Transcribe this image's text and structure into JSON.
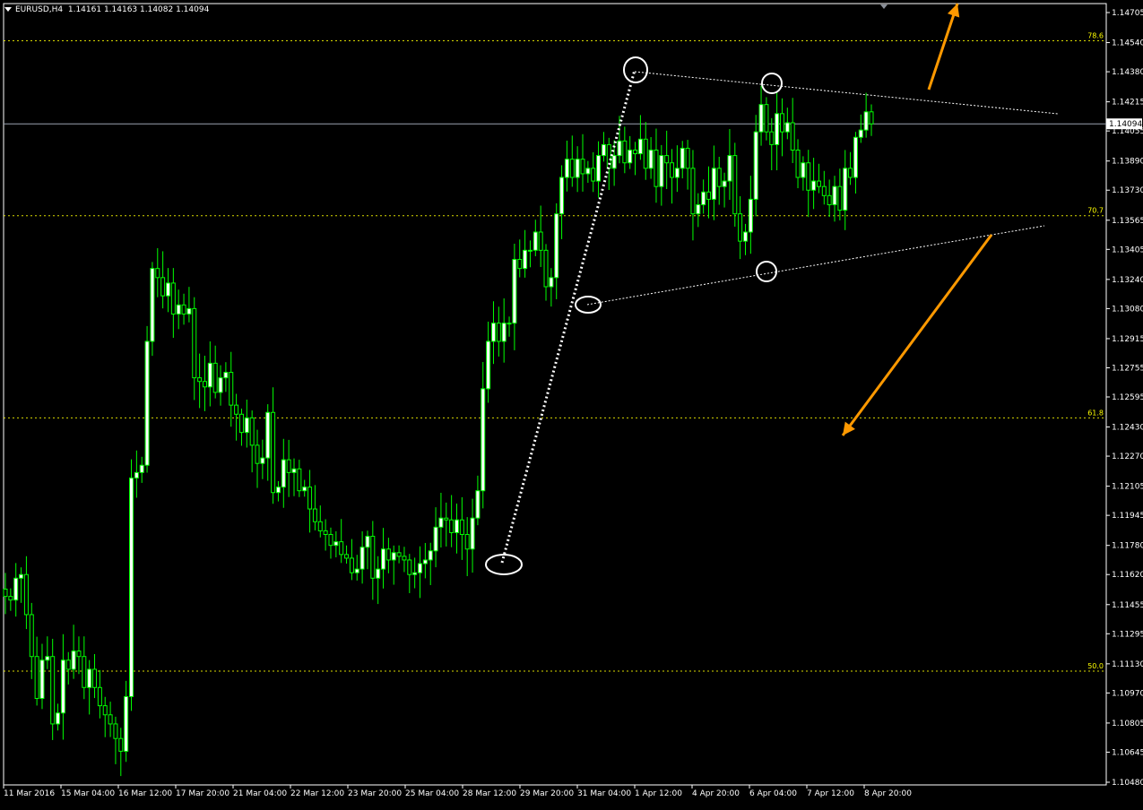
{
  "header": {
    "symbol": "EURUSD,H4",
    "ohlc": "1.14161 1.14163 1.14082 1.14094"
  },
  "colors": {
    "background": "#000000",
    "candle": "#00ff00",
    "bull_body": "#ffffff",
    "fib_line": "#ffff00",
    "axis": "#ffffff",
    "bid_line": "#9aa3b0",
    "arrow": "#ff9900",
    "annotation": "#ffffff"
  },
  "chart_data": {
    "type": "candlestick",
    "symbol": "EURUSD",
    "timeframe": "H4",
    "ylim": [
      1.1048,
      1.14705
    ],
    "grid": false,
    "y_ticks": [
      "1.14705",
      "1.14540",
      "1.14380",
      "1.14215",
      "1.14055",
      "1.13890",
      "1.13730",
      "1.13565",
      "1.13405",
      "1.13240",
      "1.13080",
      "1.12915",
      "1.12755",
      "1.12595",
      "1.12430",
      "1.12270",
      "1.12105",
      "1.11945",
      "1.11780",
      "1.11620",
      "1.11455",
      "1.11295",
      "1.11130",
      "1.10970",
      "1.10805",
      "1.10645",
      "1.10480"
    ],
    "x_ticks": [
      "11 Mar 2016",
      "15 Mar 04:00",
      "16 Mar 12:00",
      "17 Mar 20:00",
      "21 Mar 04:00",
      "22 Mar 12:00",
      "23 Mar 20:00",
      "25 Mar 04:00",
      "28 Mar 12:00",
      "29 Mar 20:00",
      "31 Mar 04:00",
      "1 Apr 12:00",
      "4 Apr 20:00",
      "6 Apr 04:00",
      "7 Apr 12:00",
      "8 Apr 20:00"
    ],
    "current_price": "1.14094",
    "fib_levels": [
      {
        "label": "78.6",
        "price": 1.1455
      },
      {
        "label": "70.7",
        "price": 1.1359
      },
      {
        "label": "61.8",
        "price": 1.1248
      },
      {
        "label": "50.0",
        "price": 1.1109
      }
    ],
    "candles_close": [
      1.115,
      1.1148,
      1.116,
      1.1162,
      1.114,
      1.1117,
      1.1094,
      1.1115,
      1.1117,
      1.108,
      1.1086,
      1.1115,
      1.111,
      1.112,
      1.1117,
      1.11,
      1.111,
      1.11,
      1.109,
      1.1085,
      1.108,
      1.1072,
      1.1065,
      1.1095,
      1.1215,
      1.1218,
      1.1222,
      1.129,
      1.133,
      1.1325,
      1.1315,
      1.1322,
      1.1305,
      1.131,
      1.1305,
      1.1308,
      1.127,
      1.1268,
      1.1265,
      1.1278,
      1.1262,
      1.127,
      1.1273,
      1.1255,
      1.125,
      1.124,
      1.1248,
      1.1233,
      1.1223,
      1.1226,
      1.1251,
      1.1207,
      1.121,
      1.1225,
      1.1218,
      1.122,
      1.1208,
      1.121,
      1.1198,
      1.1191,
      1.1186,
      1.1184,
      1.1178,
      1.118,
      1.1173,
      1.1171,
      1.1163,
      1.1165,
      1.1177,
      1.1183,
      1.116,
      1.1165,
      1.1176,
      1.117,
      1.1174,
      1.1172,
      1.117,
      1.1162,
      1.1163,
      1.1168,
      1.117,
      1.1175,
      1.1188,
      1.1193,
      1.1192,
      1.1185,
      1.1192,
      1.1184,
      1.1176,
      1.1193,
      1.1208,
      1.1264,
      1.129,
      1.13,
      1.129,
      1.13,
      1.13,
      1.1335,
      1.133,
      1.134,
      1.134,
      1.135,
      1.134,
      1.132,
      1.1325,
      1.136,
      1.138,
      1.139,
      1.138,
      1.139,
      1.1382,
      1.1385,
      1.1378,
      1.1392,
      1.1398,
      1.1385,
      1.1392,
      1.14,
      1.1388,
      1.1395,
      1.1393,
      1.1401,
      1.1385,
      1.1395,
      1.1375,
      1.1392,
      1.1388,
      1.138,
      1.1385,
      1.1396,
      1.1385,
      1.136,
      1.1365,
      1.1372,
      1.1368,
      1.1385,
      1.1375,
      1.1378,
      1.1392,
      1.136,
      1.1345,
      1.135,
      1.1368,
      1.1405,
      1.142,
      1.1405,
      1.1398,
      1.1415,
      1.1405,
      1.141,
      1.1395,
      1.138,
      1.1388,
      1.1373,
      1.1378,
      1.1375,
      1.137,
      1.1365,
      1.1375,
      1.1362,
      1.1385,
      1.138,
      1.1402,
      1.1406,
      1.1416,
      1.14094
    ],
    "annotations": {
      "trend_lines": [
        "upper-resistance",
        "lower-support",
        "impulse-dotted"
      ],
      "circles": 5,
      "arrows": [
        "up-breakout",
        "down-breakdown"
      ]
    }
  }
}
